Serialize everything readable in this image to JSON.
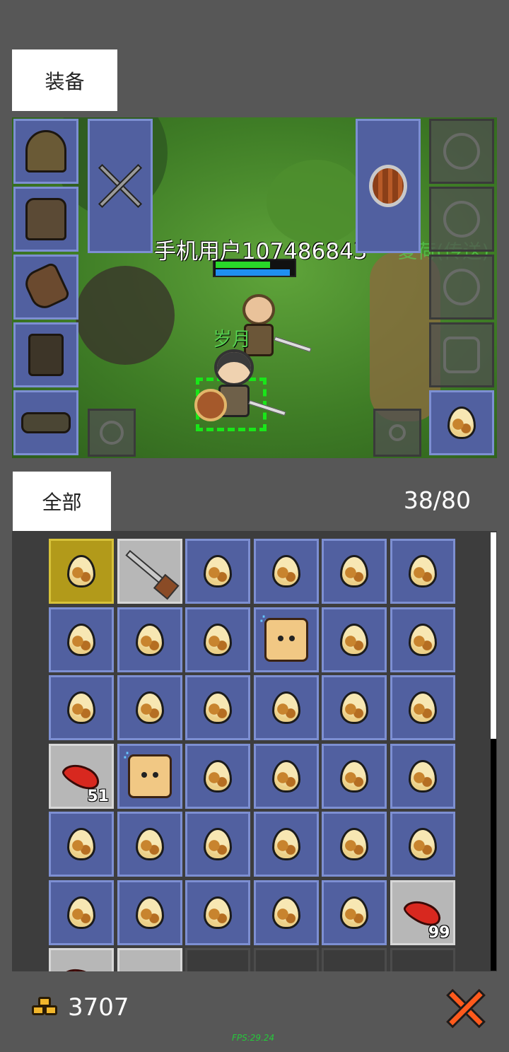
{
  "equipment": {
    "tab_label": "装备",
    "slots_left": [
      {
        "icon": "helmet-icon"
      },
      {
        "icon": "body-armor-icon"
      },
      {
        "icon": "gloves-icon"
      },
      {
        "icon": "boots-icon"
      },
      {
        "icon": "belt-icon"
      }
    ],
    "weapon_slot": {
      "icon": "crossed-swords-icon"
    },
    "offhand_slot": {
      "icon": "round-shield-icon"
    },
    "accessory_slots": [
      {
        "icon": "amulet-placeholder-icon"
      },
      {
        "icon": "ring-placeholder-icon"
      },
      {
        "icon": "ring-placeholder-icon"
      },
      {
        "icon": "pet-placeholder-icon"
      }
    ],
    "egg_slot": {
      "icon": "egg-icon"
    }
  },
  "scene": {
    "player_name": "手机用户107486843",
    "npc_name": "岁月",
    "npc2_name": "夏荷(传送)",
    "player_hp_fraction": 0.7,
    "player_mp_fraction": 0.95
  },
  "inventory": {
    "tab_label": "全部",
    "count": "38/80",
    "rows": [
      [
        {
          "type": "egg",
          "style": "gold"
        },
        {
          "type": "sword",
          "style": "gray"
        },
        {
          "type": "egg"
        },
        {
          "type": "egg"
        },
        {
          "type": "egg"
        },
        {
          "type": "egg"
        }
      ],
      [
        {
          "type": "egg"
        },
        {
          "type": "egg"
        },
        {
          "type": "egg"
        },
        {
          "type": "pet"
        },
        {
          "type": "egg"
        },
        {
          "type": "egg"
        }
      ],
      [
        {
          "type": "egg"
        },
        {
          "type": "egg"
        },
        {
          "type": "egg"
        },
        {
          "type": "egg"
        },
        {
          "type": "egg"
        },
        {
          "type": "egg"
        }
      ],
      [
        {
          "type": "meat",
          "style": "gray",
          "qty": "51"
        },
        {
          "type": "pet"
        },
        {
          "type": "egg"
        },
        {
          "type": "egg"
        },
        {
          "type": "egg"
        },
        {
          "type": "egg"
        }
      ],
      [
        {
          "type": "egg"
        },
        {
          "type": "egg"
        },
        {
          "type": "egg"
        },
        {
          "type": "egg"
        },
        {
          "type": "egg"
        },
        {
          "type": "egg"
        }
      ],
      [
        {
          "type": "egg"
        },
        {
          "type": "egg"
        },
        {
          "type": "egg"
        },
        {
          "type": "egg"
        },
        {
          "type": "egg"
        },
        {
          "type": "meat",
          "style": "gray",
          "qty": "99"
        }
      ],
      [
        {
          "type": "meat",
          "style": "gray"
        },
        {
          "type": "chest",
          "style": "gray"
        },
        {
          "type": "empty",
          "style": "dark"
        },
        {
          "type": "empty",
          "style": "dark"
        },
        {
          "type": "empty",
          "style": "dark"
        },
        {
          "type": "empty",
          "style": "dark"
        }
      ]
    ]
  },
  "footer": {
    "gold_amount": "3707",
    "fps": "FPS:29.24",
    "close_icon": "close-x-icon"
  },
  "colors": {
    "background": "#575757",
    "slot_blue": "#5160a0",
    "slot_border": "#7d8fd2",
    "selected_gold": "#b29a1a",
    "name_green": "#56d050",
    "fps_green": "#25c93a",
    "close_orange": "#ff5a1c"
  }
}
